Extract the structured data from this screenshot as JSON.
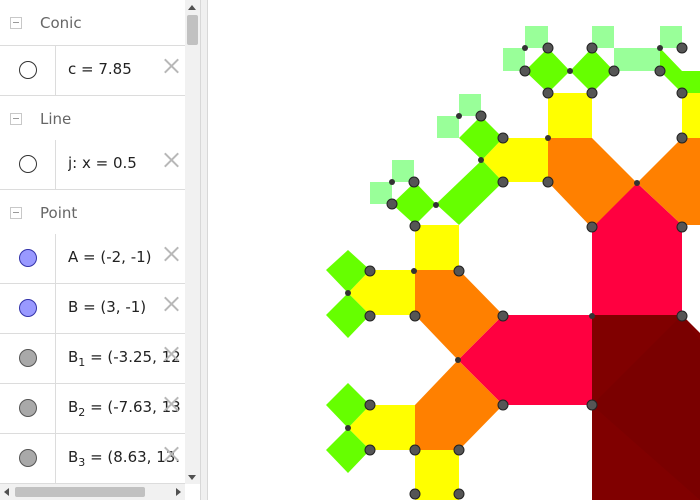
{
  "algebra": {
    "groups": {
      "conic": "Conic",
      "line": "Line",
      "point": "Point"
    },
    "conic_items": [
      {
        "text": "c = 7.85"
      }
    ],
    "line_items": [
      {
        "text": "j: x = 0.5"
      }
    ],
    "point_items": [
      {
        "name": "A",
        "sub": "",
        "value": " = (-2, -1)"
      },
      {
        "name": "B",
        "sub": "",
        "value": " = (3, -1)"
      },
      {
        "name": "B",
        "sub": "1",
        "value": " = (-3.25, 12"
      },
      {
        "name": "B",
        "sub": "2",
        "value": " = (-7.63, 13"
      },
      {
        "name": "B",
        "sub": "3",
        "value": " = (8.63, 13."
      }
    ]
  },
  "colors": {
    "darkred": "#800000",
    "red": "#ff0040",
    "orange": "#ff8000",
    "yellow": "#ffff00",
    "green": "#66ff00",
    "lightgreen": "#99ff99",
    "point_blue": "#9999ff",
    "point_gray": "#a9a9a9"
  }
}
